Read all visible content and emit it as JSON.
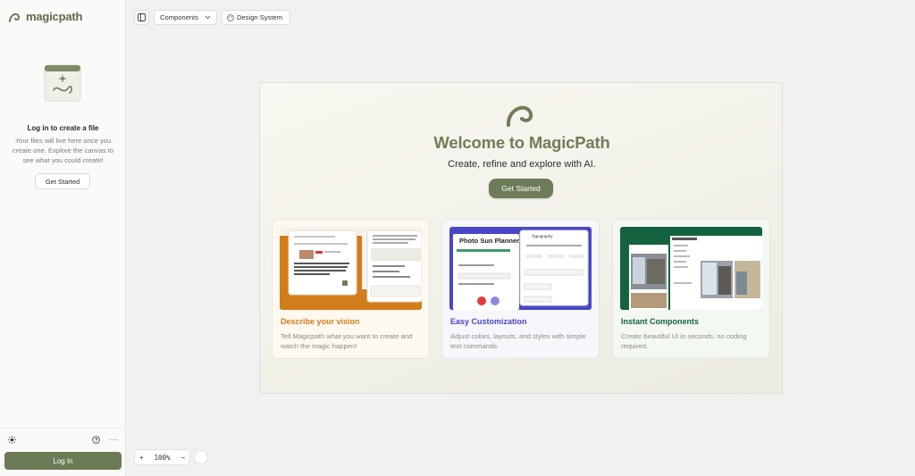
{
  "sidebar": {
    "brand": "magicpath",
    "empty_title": "Log in to create a file",
    "empty_desc": "Your files will live here once you create one. Explore the canvas to see what you could create!",
    "get_started_label": "Get Started",
    "login_label": "Log In",
    "more_label": "···"
  },
  "toolbar": {
    "components_label": "Components",
    "design_system_label": "Design System"
  },
  "hero": {
    "title": "Welcome to MagicPath",
    "subtitle": "Create, refine and explore with AI.",
    "cta_label": "Get Started"
  },
  "features": [
    {
      "title": "Describe your vision",
      "desc": "Tell Magicpath what you want to create and watch the magic happen!",
      "accent": "#d17d1a"
    },
    {
      "title": "Easy Customization",
      "desc": "Adjust colors, layouts, and styles with simple text commands.",
      "accent": "#4a47c6"
    },
    {
      "title": "Instant Components",
      "desc": "Create beautiful UI in seconds, no coding required.",
      "accent": "#14623f"
    }
  ],
  "previews": {
    "photo_sun_planner": "Photo Sun Planner",
    "typography": "Typography"
  },
  "zoom": {
    "level": "100%",
    "plus": "+",
    "minus": "−"
  },
  "colors": {
    "brand": "#6d7c58",
    "title_green": "#6e7d5a"
  }
}
